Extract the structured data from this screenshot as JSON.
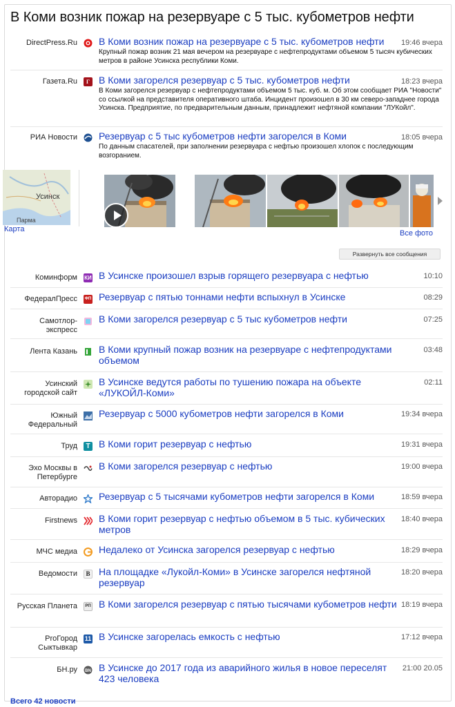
{
  "title": "В Коми возник пожар на резервуаре с 5 тыс. кубометров нефти",
  "top_items": [
    {
      "source": "DirectPress.Ru",
      "icon": "directpress-icon",
      "headline": "В Коми возник пожар на резервуаре с 5 тыс. кубометров нефти",
      "time": "19:46 вчера",
      "desc": "Крупный пожар возник 21 мая вечером на резервуаре с нефтепродуктами объемом 5 тысяч кубических метров в районе Усинска республики Коми."
    },
    {
      "source": "Газета.Ru",
      "icon": "gazeta-icon",
      "headline": "В Коми загорелся резервуар с 5 тыс. кубометров нефти",
      "time": "18:23 вчера",
      "desc": "В Коми загорелся резервуар с нефтепродуктами объемом 5 тыс. куб. м. Об этом сообщает РИА \"Новости\" со ссылкой на представителя оперативного штаба. Инцидент произошел в 30 км северо-западнее города Усинска. Предприятие, по предварительным данным, принадлежит нефтяной компании \"ЛУКойл\"."
    },
    {
      "source": "РИА Новости",
      "icon": "ria-icon",
      "headline": "Резервуар с 5 тыс кубометров нефти загорелся в Коми",
      "time": "18:05 вчера",
      "desc": "По данным спасателей, при заполнении резервуара с нефтью произошел хлопок с последующим возгоранием."
    }
  ],
  "map": {
    "label": "Карта",
    "city": "Усинск",
    "city2": "Парма"
  },
  "all_photos": "Все фото",
  "expand_button": "Развернуть все сообщения",
  "rows": [
    {
      "source": "Коминформ",
      "icon": "kominform-icon",
      "headline": "В Усинске произошел взрыв горящего резервуара с нефтью",
      "time": "10:10"
    },
    {
      "source": "ФедералПресс",
      "icon": "federalpress-icon",
      "headline": "Резервуар с пятью тоннами нефти вспыхнул в Усинске",
      "time": "08:29"
    },
    {
      "source": "Самотлор-экспресс",
      "icon": "samotlor-icon",
      "headline": "В Коми загорелся резервуар с 5 тыс кубометров нефти",
      "time": "07:25"
    },
    {
      "source": "Лента Казань",
      "icon": "lenta-kazan-icon",
      "headline": "В Коми крупный пожар возник на резервуаре с нефтепродуктами объемом",
      "time": "03:48"
    },
    {
      "source": "Усинский городской сайт",
      "icon": "usinsk-site-icon",
      "headline": "В Усинске ведутся работы по тушению пожара на объекте «ЛУКОЙЛ-Коми»",
      "time": "02:11"
    },
    {
      "source": "Южный Федеральный",
      "icon": "yuzhny-icon",
      "headline": "Резервуар с 5000 кубометров нефти загорелся в Коми",
      "time": "19:34 вчера"
    },
    {
      "source": "Труд",
      "icon": "trud-icon",
      "headline": "В Коми горит резервуар с нефтью",
      "time": "19:31 вчера"
    },
    {
      "source": "Эхо Москвы в Петербурге",
      "icon": "echo-icon",
      "headline": "В Коми загорелся резервуар с нефтью",
      "time": "19:00 вчера"
    },
    {
      "source": "Авторадио",
      "icon": "avtoradio-icon",
      "headline": "Резервуар с 5 тысячами кубометров нефти загорелся в Коми",
      "time": "18:59 вчера"
    },
    {
      "source": "Firstnews",
      "icon": "firstnews-icon",
      "headline": "В Коми горит резервуар с нефтью объемом в 5 тыс. кубических метров",
      "time": "18:40 вчера"
    },
    {
      "source": "МЧС медиа",
      "icon": "mchs-icon",
      "headline": "Недалеко от Усинска загорелся резервуар с нефтью",
      "time": "18:29 вчера"
    },
    {
      "source": "Ведомости",
      "icon": "vedomosti-icon",
      "headline": "На площадке «Лукойл-Коми» в Усинске загорелся нефтяной резервуар",
      "time": "18:20 вчера"
    },
    {
      "source": "Русская Планета",
      "icon": "rusplaneta-icon",
      "headline": "В Коми загорелся резервуар с пятью тысячами кубометров нефти",
      "time": "18:19 вчера"
    },
    {
      "source": "ProГород Сыктывкар",
      "icon": "progorod-icon",
      "headline": "В Усинске загорелась емкость с нефтью",
      "time": "17:12 вчера"
    },
    {
      "source": "БН.ру",
      "icon": "bn-icon",
      "headline": "В Усинске до 2017 года из аварийного жилья в новое переселят 423 человека",
      "time": "21:00 20.05"
    }
  ],
  "total": "Всего 42 новости"
}
